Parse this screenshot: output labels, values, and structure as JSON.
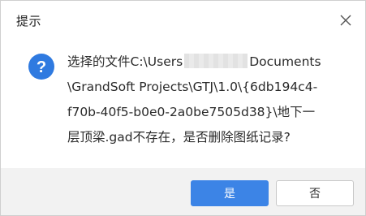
{
  "dialog": {
    "title": "提示",
    "close_icon": "close-icon",
    "question_icon": "question-icon",
    "icon_glyph": "?",
    "accent_color": "#3c84e6",
    "message": {
      "line1_prefix": "选择的文件C:\\Users",
      "line1_suffix": "Documents",
      "line2": "\\GrandSoft Projects\\GTJ\\1.0\\{6db194c4-",
      "line3": "f70b-40f5-b0e0-2a0be7505d38}\\地下一",
      "line4": "层顶梁.gad不存在，是否删除图纸记录?"
    },
    "buttons": {
      "yes_label": "是",
      "no_label": "否"
    }
  }
}
